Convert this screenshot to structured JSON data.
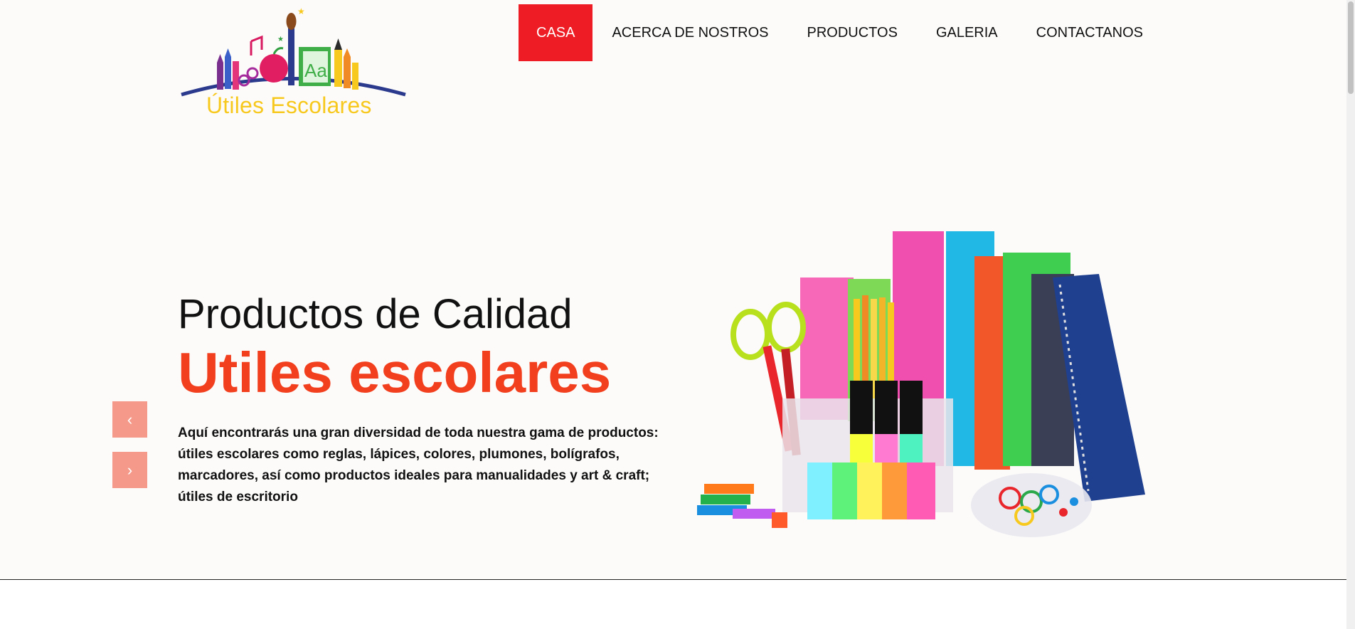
{
  "logo": {
    "text": "Útiles Escolares",
    "aa_text": "Aa"
  },
  "nav": {
    "items": [
      {
        "label": "CASA",
        "active": true
      },
      {
        "label": "ACERCA DE NOSTROS",
        "active": false
      },
      {
        "label": "PRODUCTOS",
        "active": false
      },
      {
        "label": "GALERIA",
        "active": false
      },
      {
        "label": "CONTACTANOS",
        "active": false
      }
    ]
  },
  "hero": {
    "title_line1": "Productos de Calidad",
    "title_line2": "Utiles escolares",
    "description": "Aquí encontrarás una gran diversidad de toda nuestra gama de productos: útiles escolares como reglas, lápices, colores, plumones, bolígrafos, marcadores, así como productos ideales para manualidades y art & craft; útiles de escritorio",
    "prev_arrow": "‹",
    "next_arrow": "›"
  },
  "colors": {
    "accent_red": "#ee1c25",
    "title_orange": "#f2401f",
    "arrow_bg": "#f59a8a",
    "logo_yellow": "#f7c81e"
  },
  "icons": {
    "prev": "chevron-left-icon",
    "next": "chevron-right-icon"
  }
}
